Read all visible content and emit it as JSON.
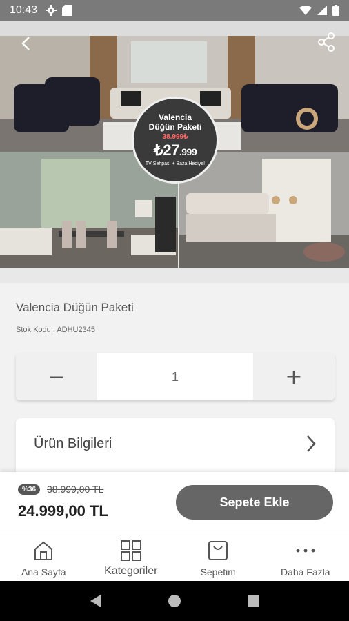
{
  "status_bar": {
    "time": "10:43"
  },
  "promo": {
    "title_line1": "Valencia",
    "title_line2": "Düğün Paketi",
    "old_price": "38.999₺",
    "new_price_main": "₺27",
    "new_price_decimals": ".999",
    "gift_text": "TV Sehpası + Baza Hediye!"
  },
  "product": {
    "title": "Valencia Düğün Paketi",
    "stock_code": "Stok Kodu : ADHU2345"
  },
  "quantity": {
    "minus": "−",
    "value": "1",
    "plus": "+"
  },
  "info": {
    "label": "Ürün Bilgileri"
  },
  "price": {
    "discount": "%36",
    "old": "38.999,00 TL",
    "new": "24.999,00 TL",
    "add_to_cart": "Sepete Ekle"
  },
  "tabs": [
    {
      "label": "Ana Sayfa",
      "icon": "home-icon"
    },
    {
      "label": "Kategoriler",
      "icon": "grid-icon"
    },
    {
      "label": "Sepetim",
      "icon": "bag-icon"
    },
    {
      "label": "Daha Fazla",
      "icon": "more-icon"
    }
  ],
  "colors": {
    "accent": "#666666",
    "status_bar": "#7a7a7a",
    "promo_bg": "#3a3a3a",
    "promo_old_price": "#ff6b6b"
  }
}
